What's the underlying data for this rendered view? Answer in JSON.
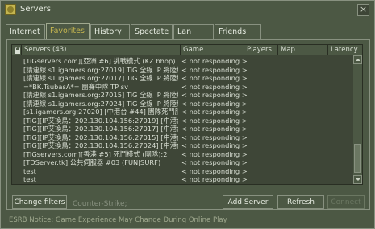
{
  "window": {
    "title": "Servers",
    "close_glyph": "×"
  },
  "tabs": [
    {
      "label": "Internet",
      "active": false
    },
    {
      "label": "Favorites",
      "active": true
    },
    {
      "label": "History",
      "active": false
    },
    {
      "label": "Spectate",
      "active": false
    },
    {
      "label": "Lan",
      "active": false
    },
    {
      "label": "Friends",
      "active": false
    }
  ],
  "table": {
    "columns": {
      "servers": "Servers (43)",
      "game": "Game",
      "players": "Players",
      "map": "Map",
      "latency": "Latency"
    },
    "rows": [
      {
        "name": "[TiGservers.com][亞洲 #6] 挑戰模式 (KZ.bhop)",
        "game": "< not responding >"
      },
      {
        "name": "[請連線 s1.igamers.org:27019] TiG 全線 IP 將陸續...",
        "game": "< not responding >"
      },
      {
        "name": "[請連線 s1.igamers.org:27017] TiG 全線 IP 將陸續...",
        "game": "< not responding >"
      },
      {
        "name": "=*BK.TsubasA*= 團賽中隊 TP sv",
        "game": "< not responding >"
      },
      {
        "name": "[請連線 s1.igamers.org:27015] TiG 全線 IP 將陸續...",
        "game": "< not responding >"
      },
      {
        "name": "[請連線 s1.igamers.org:27024] TiG 全線 IP 將陸續...",
        "game": "< not responding >"
      },
      {
        "name": "[s1.igamers.org:27020] [中港台 #44] 團隊死鬥服",
        "game": "< not responding >"
      },
      {
        "name": "[TiG][IP艾換鳥：202.130.104.156:27019] [中港台]...",
        "game": "< not responding >"
      },
      {
        "name": "[TiG][IP艾換鳥：202.130.104.156:27017] [中港台]...",
        "game": "< not responding >"
      },
      {
        "name": "[TiG][IP艾換鳥：202.130.104.156:27015] [中港台]...",
        "game": "< not responding >"
      },
      {
        "name": "[TiG][IP艾換鳥：202.130.104.156:27024] [中港台]...",
        "game": "< not responding >"
      },
      {
        "name": "[TiGservers.com][香港 #5] 死鬥模式 (團隊):2",
        "game": "< not responding >"
      },
      {
        "name": "[TDServer.tk] 公共伺服器 #03 (FUN|SURF)",
        "game": "< not responding >"
      },
      {
        "name": "test",
        "game": "< not responding >"
      },
      {
        "name": "test",
        "game": "< not responding >"
      }
    ]
  },
  "controls": {
    "change_filters": "Change filters",
    "filter_text": "Counter-Strike;",
    "add_server": "Add Server",
    "refresh": "Refresh",
    "connect": "Connect"
  },
  "status": {
    "notice": "ESRB Notice: Game Experience May Change During Online Play"
  },
  "icons": {
    "title": "steam-icon",
    "lock": "lock-icon"
  },
  "colors": {
    "background": "#4c5844",
    "list_background": "#3e4637",
    "accent": "#c4b550",
    "text": "#d8ded3",
    "border": "#889180"
  }
}
